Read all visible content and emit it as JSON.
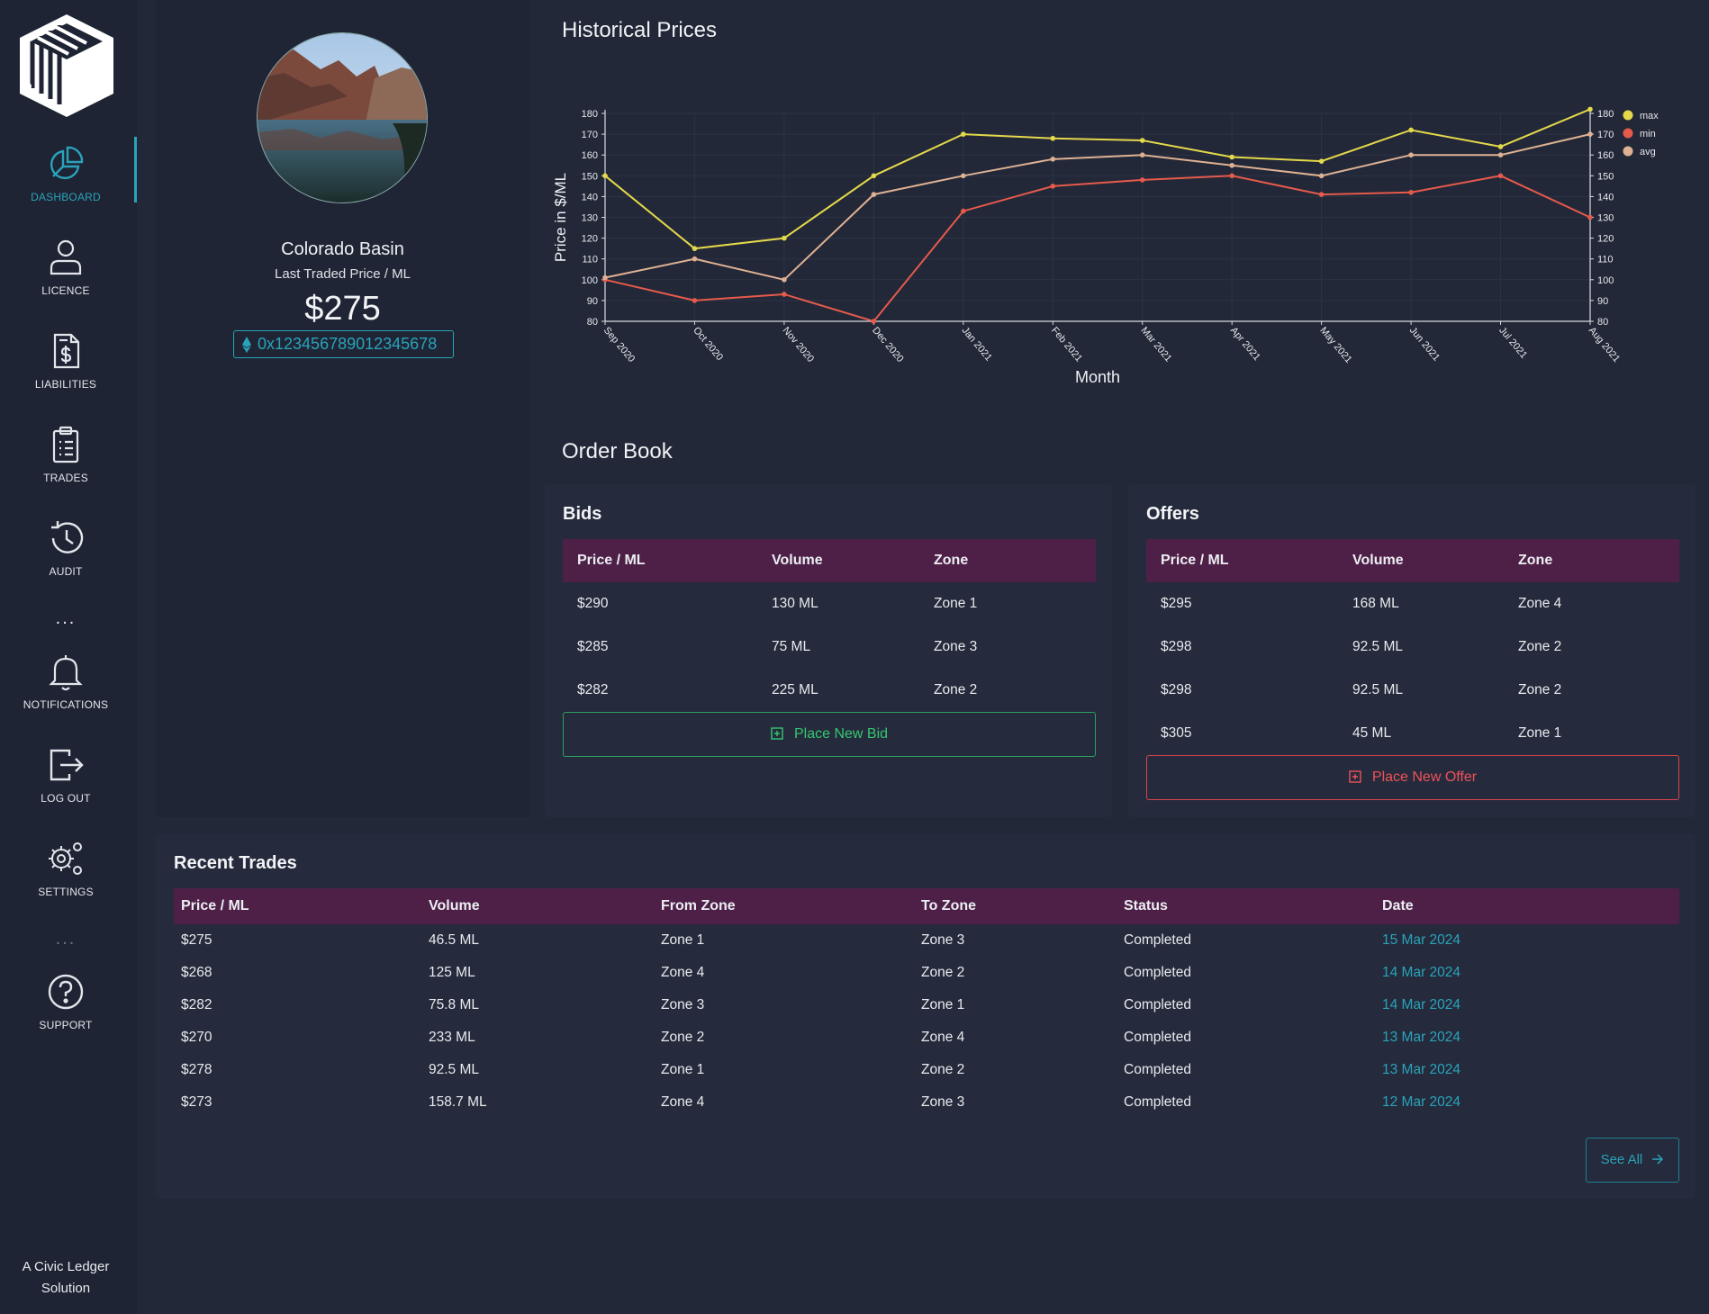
{
  "sidebar": {
    "items": [
      {
        "label": "DASHBOARD",
        "icon": "pie-chart-icon"
      },
      {
        "label": "LICENCE",
        "icon": "user-icon"
      },
      {
        "label": "LIABILITIES",
        "icon": "dollar-document-icon"
      },
      {
        "label": "TRADES",
        "icon": "clipboard-list-icon"
      },
      {
        "label": "AUDIT",
        "icon": "history-icon"
      },
      {
        "label": "NOTIFICATIONS",
        "icon": "bell-icon"
      },
      {
        "label": "LOG OUT",
        "icon": "logout-icon"
      },
      {
        "label": "SETTINGS",
        "icon": "gears-icon"
      },
      {
        "label": "SUPPORT",
        "icon": "question-circle-icon"
      }
    ],
    "dots_1": "...",
    "dots_2": "...",
    "footer_line1": "A Civic Ledger",
    "footer_line2": "Solution",
    "accent": "#29a3ba"
  },
  "profile": {
    "name": "Colorado Basin",
    "last_traded_label": "Last Traded Price / ML",
    "last_traded_price": "$275",
    "address": "0x123456789012345678"
  },
  "historical": {
    "title": "Historical Prices"
  },
  "chart_data": {
    "type": "line",
    "x": [
      "Sep 2020",
      "Oct 2020",
      "Nov 2020",
      "Dec 2020",
      "Jan 2021",
      "Feb 2021",
      "Mar 2021",
      "Apr 2021",
      "May 2021",
      "Jun 2021",
      "Jul 2021",
      "Aug 2021"
    ],
    "series": [
      {
        "name": "max",
        "color": "#e4d94a",
        "values": [
          150,
          115,
          120,
          150,
          170,
          168,
          167,
          159,
          157,
          172,
          164,
          182
        ]
      },
      {
        "name": "min",
        "color": "#e65a4c",
        "values": [
          100,
          90,
          93,
          80,
          133,
          145,
          148,
          150,
          141,
          142,
          150,
          130
        ]
      },
      {
        "name": "avg",
        "color": "#dfb193",
        "values": [
          101,
          110,
          100,
          141,
          150,
          158,
          160,
          155,
          150,
          160,
          160,
          170
        ]
      }
    ],
    "xlabel": "Month",
    "ylabel": "Price in $/ML",
    "ylim": [
      80,
      180
    ],
    "yticks": [
      80,
      90,
      100,
      110,
      120,
      130,
      140,
      150,
      160,
      170,
      180
    ],
    "dual_axis": true,
    "legend": "top-right"
  },
  "orderbook": {
    "title": "Order Book",
    "bids": {
      "title": "Bids",
      "headers": [
        "Price / ML",
        "Volume",
        "Zone"
      ],
      "rows": [
        [
          "$290",
          "130 ML",
          "Zone 1"
        ],
        [
          "$285",
          "75 ML",
          "Zone 3"
        ],
        [
          "$282",
          "225 ML",
          "Zone 2"
        ]
      ],
      "button": "Place New Bid"
    },
    "offers": {
      "title": "Offers",
      "headers": [
        "Price / ML",
        "Volume",
        "Zone"
      ],
      "rows": [
        [
          "$295",
          "168 ML",
          "Zone 4"
        ],
        [
          "$298",
          "92.5 ML",
          "Zone 2"
        ],
        [
          "$298",
          "92.5 ML",
          "Zone 2"
        ],
        [
          "$305",
          "45 ML",
          "Zone 1"
        ]
      ],
      "button": "Place New Offer"
    }
  },
  "recent": {
    "title": "Recent Trades",
    "headers": [
      "Price / ML",
      "Volume",
      "From Zone",
      "To Zone",
      "Status",
      "Date"
    ],
    "rows": [
      [
        "$275",
        "46.5 ML",
        "Zone 1",
        "Zone 3",
        "Completed",
        "15 Mar 2024"
      ],
      [
        "$268",
        "125 ML",
        "Zone 4",
        "Zone 2",
        "Completed",
        "14 Mar 2024"
      ],
      [
        "$282",
        "75.8 ML",
        "Zone 3",
        "Zone 1",
        "Completed",
        "14 Mar 2024"
      ],
      [
        "$270",
        "233 ML",
        "Zone 2",
        "Zone 4",
        "Completed",
        "13 Mar 2024"
      ],
      [
        "$278",
        "92.5 ML",
        "Zone 1",
        "Zone 2",
        "Completed",
        "13 Mar 2024"
      ],
      [
        "$273",
        "158.7 ML",
        "Zone 4",
        "Zone 3",
        "Completed",
        "12 Mar 2024"
      ]
    ],
    "see_all": "See All"
  }
}
